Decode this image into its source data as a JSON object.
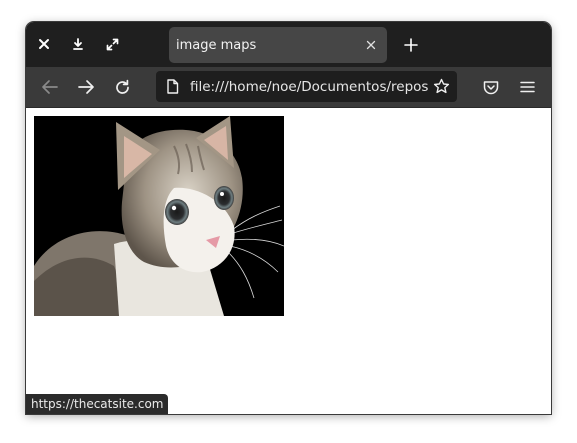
{
  "titlebar": {
    "buttons": {
      "close": "close-icon",
      "download": "download-icon",
      "fullscreen": "fullscreen-icon"
    }
  },
  "tab": {
    "title": "image maps",
    "close_icon": "close-icon"
  },
  "new_tab_icon": "plus-icon",
  "toolbar": {
    "back_icon": "arrow-left-icon",
    "forward_icon": "arrow-right-icon",
    "reload_icon": "reload-icon",
    "page_icon": "document-icon",
    "url": "file:///home/noe/Documentos/repos/learning-html/image_maps.html",
    "bookmark_icon": "star-icon",
    "pocket_icon": "pocket-icon",
    "menu_icon": "hamburger-menu-icon"
  },
  "content": {
    "image_subject": "cat photo"
  },
  "status_bar": {
    "link_url": "https://thecatsite.com"
  },
  "colors": {
    "titlebar": "#1f1f1f",
    "tab_active": "#464646",
    "toolbar": "#3a3a3a",
    "urlbar": "#1e1e1e",
    "content_bg": "#ffffff"
  }
}
